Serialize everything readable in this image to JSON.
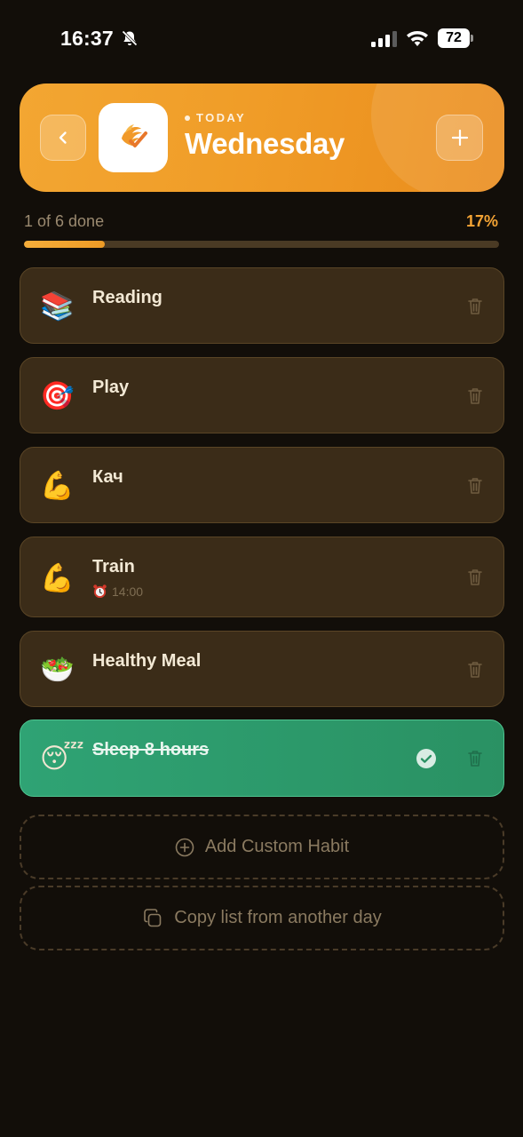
{
  "status_bar": {
    "time": "16:37",
    "battery": "72",
    "icons": [
      "bell-slash-icon",
      "cellular-signal-icon",
      "wifi-icon",
      "battery-icon"
    ]
  },
  "header": {
    "today_label": "TODAY",
    "day_title": "Wednesday",
    "back_icon": "chevron-left-icon",
    "add_icon": "plus-icon",
    "logo_icon": "app-logo-icon",
    "accent": "#F09D28"
  },
  "progress": {
    "label": "1 of 6 done",
    "percent_label": "17%",
    "fraction": 0.17,
    "accent": "#F3A334"
  },
  "habits": [
    {
      "emoji": "📚",
      "name": "Reading",
      "done": false
    },
    {
      "emoji": "🎯",
      "name": "Play",
      "done": false
    },
    {
      "emoji": "💪",
      "name": "Кач",
      "done": false
    },
    {
      "emoji": "💪",
      "name": "Train",
      "time": "14:00",
      "done": false
    },
    {
      "emoji": "🥗",
      "name": "Healthy Meal",
      "done": false
    },
    {
      "emoji": "😴",
      "name": "Sleep 8 hours",
      "done": true
    }
  ],
  "actions": {
    "add_custom": "Add Custom Habit",
    "copy_list": "Copy list from another day"
  },
  "colors": {
    "background": "#120E09",
    "card": "#3B2C18",
    "done_card": "#2FA374"
  }
}
